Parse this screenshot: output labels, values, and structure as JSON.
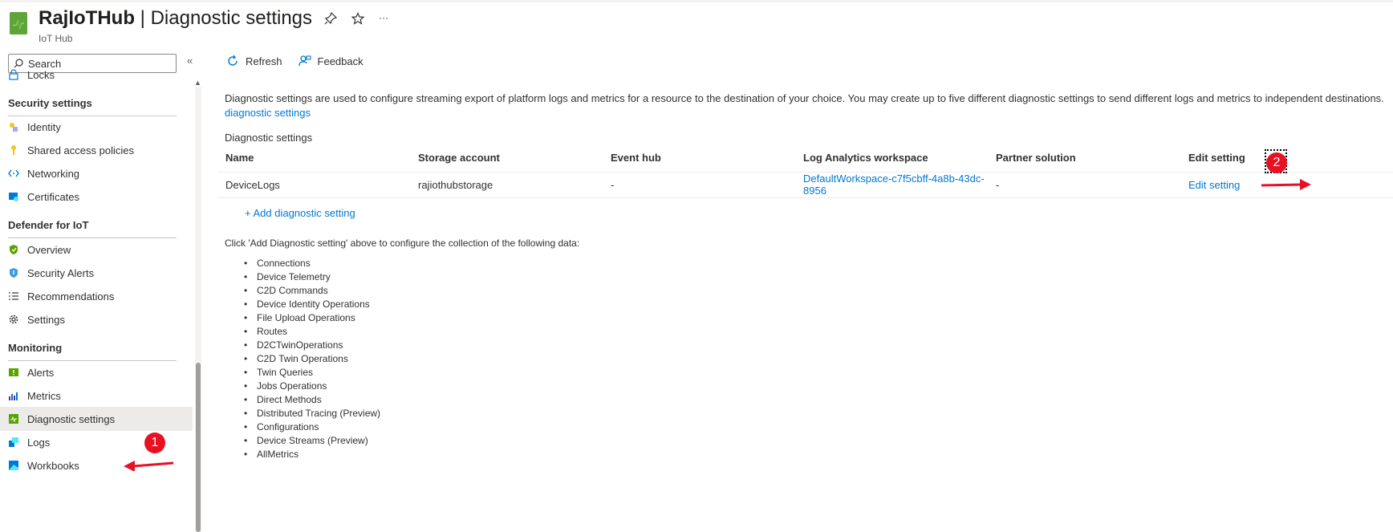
{
  "header": {
    "resource": "RajIoTHub",
    "separator": " | ",
    "page_title": "Diagnostic settings",
    "subtitle": "IoT Hub",
    "pin_icon": "pin-icon",
    "favorite_icon": "star-icon",
    "more_label": "···"
  },
  "sidebar": {
    "search_placeholder": "Search",
    "collapse_label": "«",
    "locks_label": "Locks",
    "sections": {
      "security": "Security settings",
      "defender": "Defender for IoT",
      "monitoring": "Monitoring"
    },
    "items": {
      "identity": "Identity",
      "shared_access": "Shared access policies",
      "networking": "Networking",
      "certificates": "Certificates",
      "overview": "Overview",
      "security_alerts": "Security Alerts",
      "recommendations": "Recommendations",
      "settings": "Settings",
      "alerts": "Alerts",
      "metrics": "Metrics",
      "diagnostic_settings": "Diagnostic settings",
      "logs": "Logs",
      "workbooks": "Workbooks"
    }
  },
  "toolbar": {
    "refresh": "Refresh",
    "feedback": "Feedback"
  },
  "main": {
    "description": "Diagnostic settings are used to configure streaming export of platform logs and metrics for a resource to the destination of your choice. You may create up to five different diagnostic settings to send different logs and metrics to independent destinations.",
    "description_link": "diagnostic settings",
    "section_label": "Diagnostic settings",
    "table": {
      "headers": [
        "Name",
        "Storage account",
        "Event hub",
        "Log Analytics workspace",
        "Partner solution",
        "Edit setting"
      ],
      "row": {
        "name": "DeviceLogs",
        "storage": "rajiothubstorage",
        "event_hub": "-",
        "workspace": "DefaultWorkspace-c7f5cbff-4a8b-43dc-8956",
        "partner": "-",
        "edit": "Edit setting"
      }
    },
    "add_label": "+ Add diagnostic setting",
    "collection_intro": "Click 'Add Diagnostic setting' above to configure the collection of the following data:",
    "data_items": [
      "Connections",
      "Device Telemetry",
      "C2D Commands",
      "Device Identity Operations",
      "File Upload Operations",
      "Routes",
      "D2CTwinOperations",
      "C2D Twin Operations",
      "Twin Queries",
      "Jobs Operations",
      "Direct Methods",
      "Distributed Tracing (Preview)",
      "Configurations",
      "Device Streams (Preview)",
      "AllMetrics"
    ]
  },
  "annotations": {
    "step1": "1",
    "step2": "2",
    "color": "#e81123"
  }
}
